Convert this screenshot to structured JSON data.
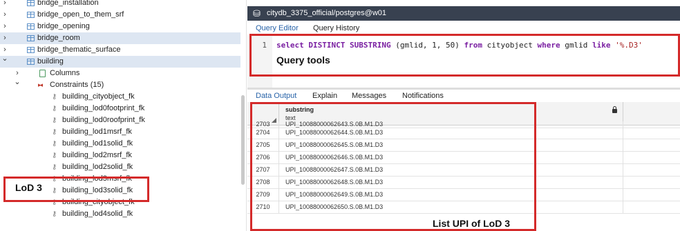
{
  "tree": {
    "items": [
      {
        "label": "bridge_installation",
        "indent": 1,
        "icon": "table-icon",
        "chevron": "right",
        "selected": false
      },
      {
        "label": "bridge_open_to_them_srf",
        "indent": 1,
        "icon": "table-icon",
        "chevron": "right",
        "selected": false
      },
      {
        "label": "bridge_opening",
        "indent": 1,
        "icon": "table-icon",
        "chevron": "right",
        "selected": false
      },
      {
        "label": "bridge_room",
        "indent": 1,
        "icon": "table-icon",
        "chevron": "right",
        "selected": true
      },
      {
        "label": "bridge_thematic_surface",
        "indent": 1,
        "icon": "table-icon",
        "chevron": "right",
        "selected": false
      },
      {
        "label": "building",
        "indent": 1,
        "icon": "table-icon",
        "chevron": "down",
        "selected": true
      },
      {
        "label": "Columns",
        "indent": 2,
        "icon": "columns-icon",
        "chevron": "right",
        "selected": false
      },
      {
        "label": "Constraints (15)",
        "indent": 2,
        "icon": "constraints-icon",
        "chevron": "down",
        "selected": false
      },
      {
        "label": "building_cityobject_fk",
        "indent": 3,
        "icon": "key-icon",
        "chevron": "",
        "selected": false
      },
      {
        "label": "building_lod0footprint_fk",
        "indent": 3,
        "icon": "key-icon",
        "chevron": "",
        "selected": false
      },
      {
        "label": "building_lod0roofprint_fk",
        "indent": 3,
        "icon": "key-icon",
        "chevron": "",
        "selected": false
      },
      {
        "label": "building_lod1msrf_fk",
        "indent": 3,
        "icon": "key-icon",
        "chevron": "",
        "selected": false
      },
      {
        "label": "building_lod1solid_fk",
        "indent": 3,
        "icon": "key-icon",
        "chevron": "",
        "selected": false
      },
      {
        "label": "building_lod2msrf_fk",
        "indent": 3,
        "icon": "key-icon",
        "chevron": "",
        "selected": false
      },
      {
        "label": "building_lod2solid_fk",
        "indent": 3,
        "icon": "key-icon",
        "chevron": "",
        "selected": false
      },
      {
        "label": "building_lod3msrf_fk",
        "indent": 3,
        "icon": "key-icon",
        "chevron": "",
        "selected": false
      },
      {
        "label": "building_lod3solid_fk",
        "indent": 3,
        "icon": "key-icon",
        "chevron": "",
        "selected": false
      },
      {
        "label": "building_cityobject_fk",
        "indent": 3,
        "icon": "key-icon",
        "chevron": "",
        "selected": false
      },
      {
        "label": "building_lod4solid_fk",
        "indent": 3,
        "icon": "key-icon",
        "chevron": "",
        "selected": false
      }
    ]
  },
  "connection": {
    "title": "citydb_3375_official/postgres@w01",
    "icon": "database-icon"
  },
  "query_tabs": [
    "Query Editor",
    "Query History"
  ],
  "editor": {
    "line_number": "1",
    "tokens": [
      {
        "text": "select DISTINCT SUBSTRING",
        "cls": "kw"
      },
      {
        "text": " (gmlid, 1, 50) ",
        "cls": "plain"
      },
      {
        "text": "from",
        "cls": "kw"
      },
      {
        "text": " cityobject ",
        "cls": "plain"
      },
      {
        "text": "where",
        "cls": "kw"
      },
      {
        "text": " gmlid ",
        "cls": "plain"
      },
      {
        "text": "like",
        "cls": "kw"
      },
      {
        "text": " '%.D3'",
        "cls": "str"
      }
    ]
  },
  "output_tabs": [
    "Data Output",
    "Explain",
    "Messages",
    "Notifications"
  ],
  "grid": {
    "column_name": "substring",
    "column_type": "text",
    "rows": [
      {
        "n": "2703",
        "v": "UPI_10088000062643.S.0B.M1.D3"
      },
      {
        "n": "2704",
        "v": "UPI_10088000062644.S.0B.M1.D3"
      },
      {
        "n": "2705",
        "v": "UPI_10088000062645.S.0B.M1.D3"
      },
      {
        "n": "2706",
        "v": "UPI_10088000062646.S.0B.M1.D3"
      },
      {
        "n": "2707",
        "v": "UPI_10088000062647.S.0B.M1.D3"
      },
      {
        "n": "2708",
        "v": "UPI_10088000062648.S.0B.M1.D3"
      },
      {
        "n": "2709",
        "v": "UPI_10088000062649.S.0B.M1.D3"
      },
      {
        "n": "2710",
        "v": "UPI_10088000062650.S.0B.M1.D3"
      }
    ]
  },
  "annotations": {
    "lod3": "LoD 3",
    "query_tools": "Query tools",
    "list_upi": "List UPI of LoD 3"
  },
  "colors": {
    "annotation": "#d42a2a",
    "accent": "#2762a8",
    "header_bar": "#384150"
  }
}
